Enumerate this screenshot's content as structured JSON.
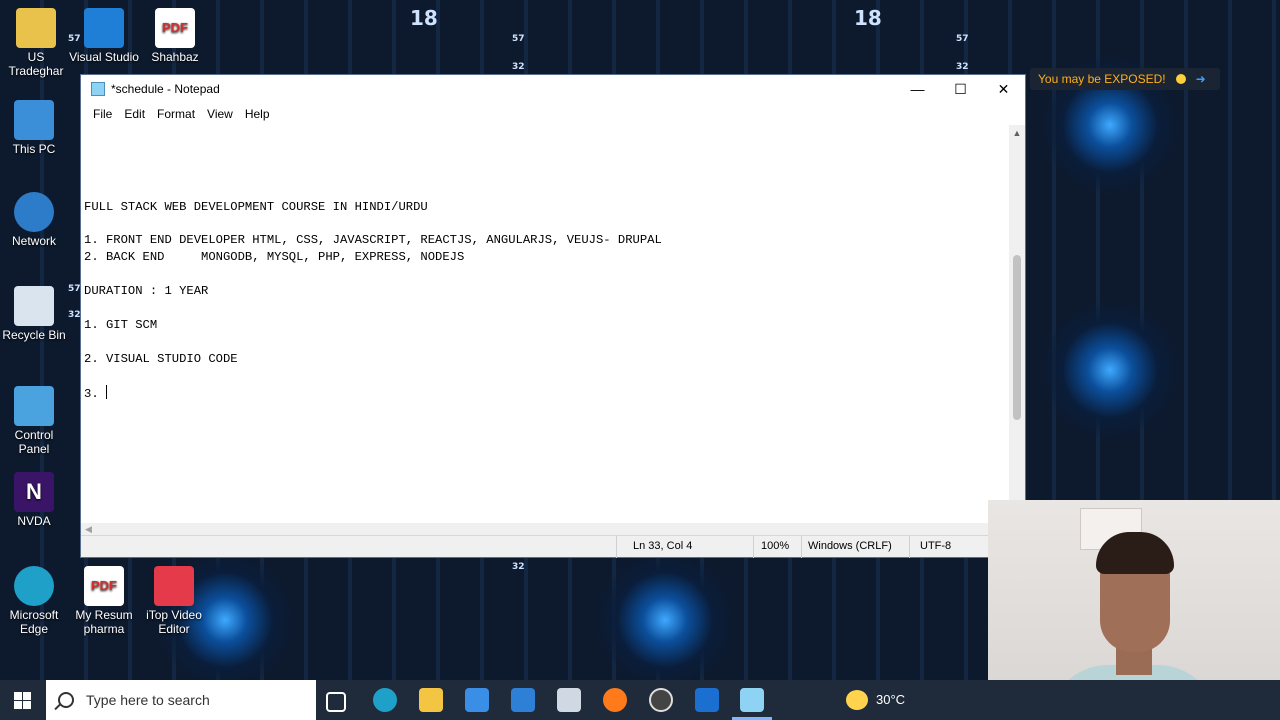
{
  "desktop": {
    "icons": [
      {
        "label": "US Tradeghar",
        "icon": "app-icon"
      },
      {
        "label": "Visual Studio",
        "icon": "vscode-icon"
      },
      {
        "label": "Shahbaz",
        "icon": "pdf-icon"
      },
      {
        "label": "This PC",
        "icon": "computer-icon"
      },
      {
        "label": "Network",
        "icon": "network-icon"
      },
      {
        "label": "Recycle Bin",
        "icon": "recycle-bin-icon"
      },
      {
        "label": "Control Panel",
        "icon": "control-panel-icon"
      },
      {
        "label": "NVDA",
        "icon": "nvda-icon"
      },
      {
        "label": "Microsoft Edge",
        "icon": "edge-icon"
      },
      {
        "label": "My Resum pharma",
        "icon": "pdf-icon"
      },
      {
        "label": "iTop Video Editor",
        "icon": "video-editor-icon"
      }
    ],
    "pdf_tag": "PDF",
    "nvda_tag": "N",
    "wallpaper_numbers": [
      "18",
      "18",
      "57",
      "57",
      "32",
      "32",
      "57",
      "57",
      "32",
      "32"
    ],
    "exposed_badge": "You may be EXPOSED!"
  },
  "notepad": {
    "title": "*schedule - Notepad",
    "menu": [
      "File",
      "Edit",
      "Format",
      "View",
      "Help"
    ],
    "lines": [
      "",
      "",
      "",
      "",
      "FULL STACK WEB DEVELOPMENT COURSE IN HINDI/URDU",
      "",
      "1. FRONT END DEVELOPER HTML, CSS, JAVASCRIPT, REACTJS, ANGULARJS, VEUJS- DRUPAL",
      "2. BACK END     MONGODB, MYSQL, PHP, EXPRESS, NODEJS",
      "",
      "DURATION : 1 YEAR",
      "",
      "1. GIT SCM",
      "",
      "2. VISUAL STUDIO CODE",
      "",
      "3. "
    ],
    "status": {
      "position": "Ln 33, Col 4",
      "zoom": "100%",
      "line_ending": "Windows (CRLF)",
      "encoding": "UTF-8"
    }
  },
  "taskbar": {
    "search_placeholder": "Type here to search",
    "temperature": "30°C",
    "apps": [
      "task-view-icon",
      "edge-icon",
      "file-explorer-icon",
      "store-icon",
      "mail-icon",
      "photos-icon",
      "firefox-icon",
      "recorder-icon",
      "shield-icon",
      "notepad-icon"
    ]
  }
}
